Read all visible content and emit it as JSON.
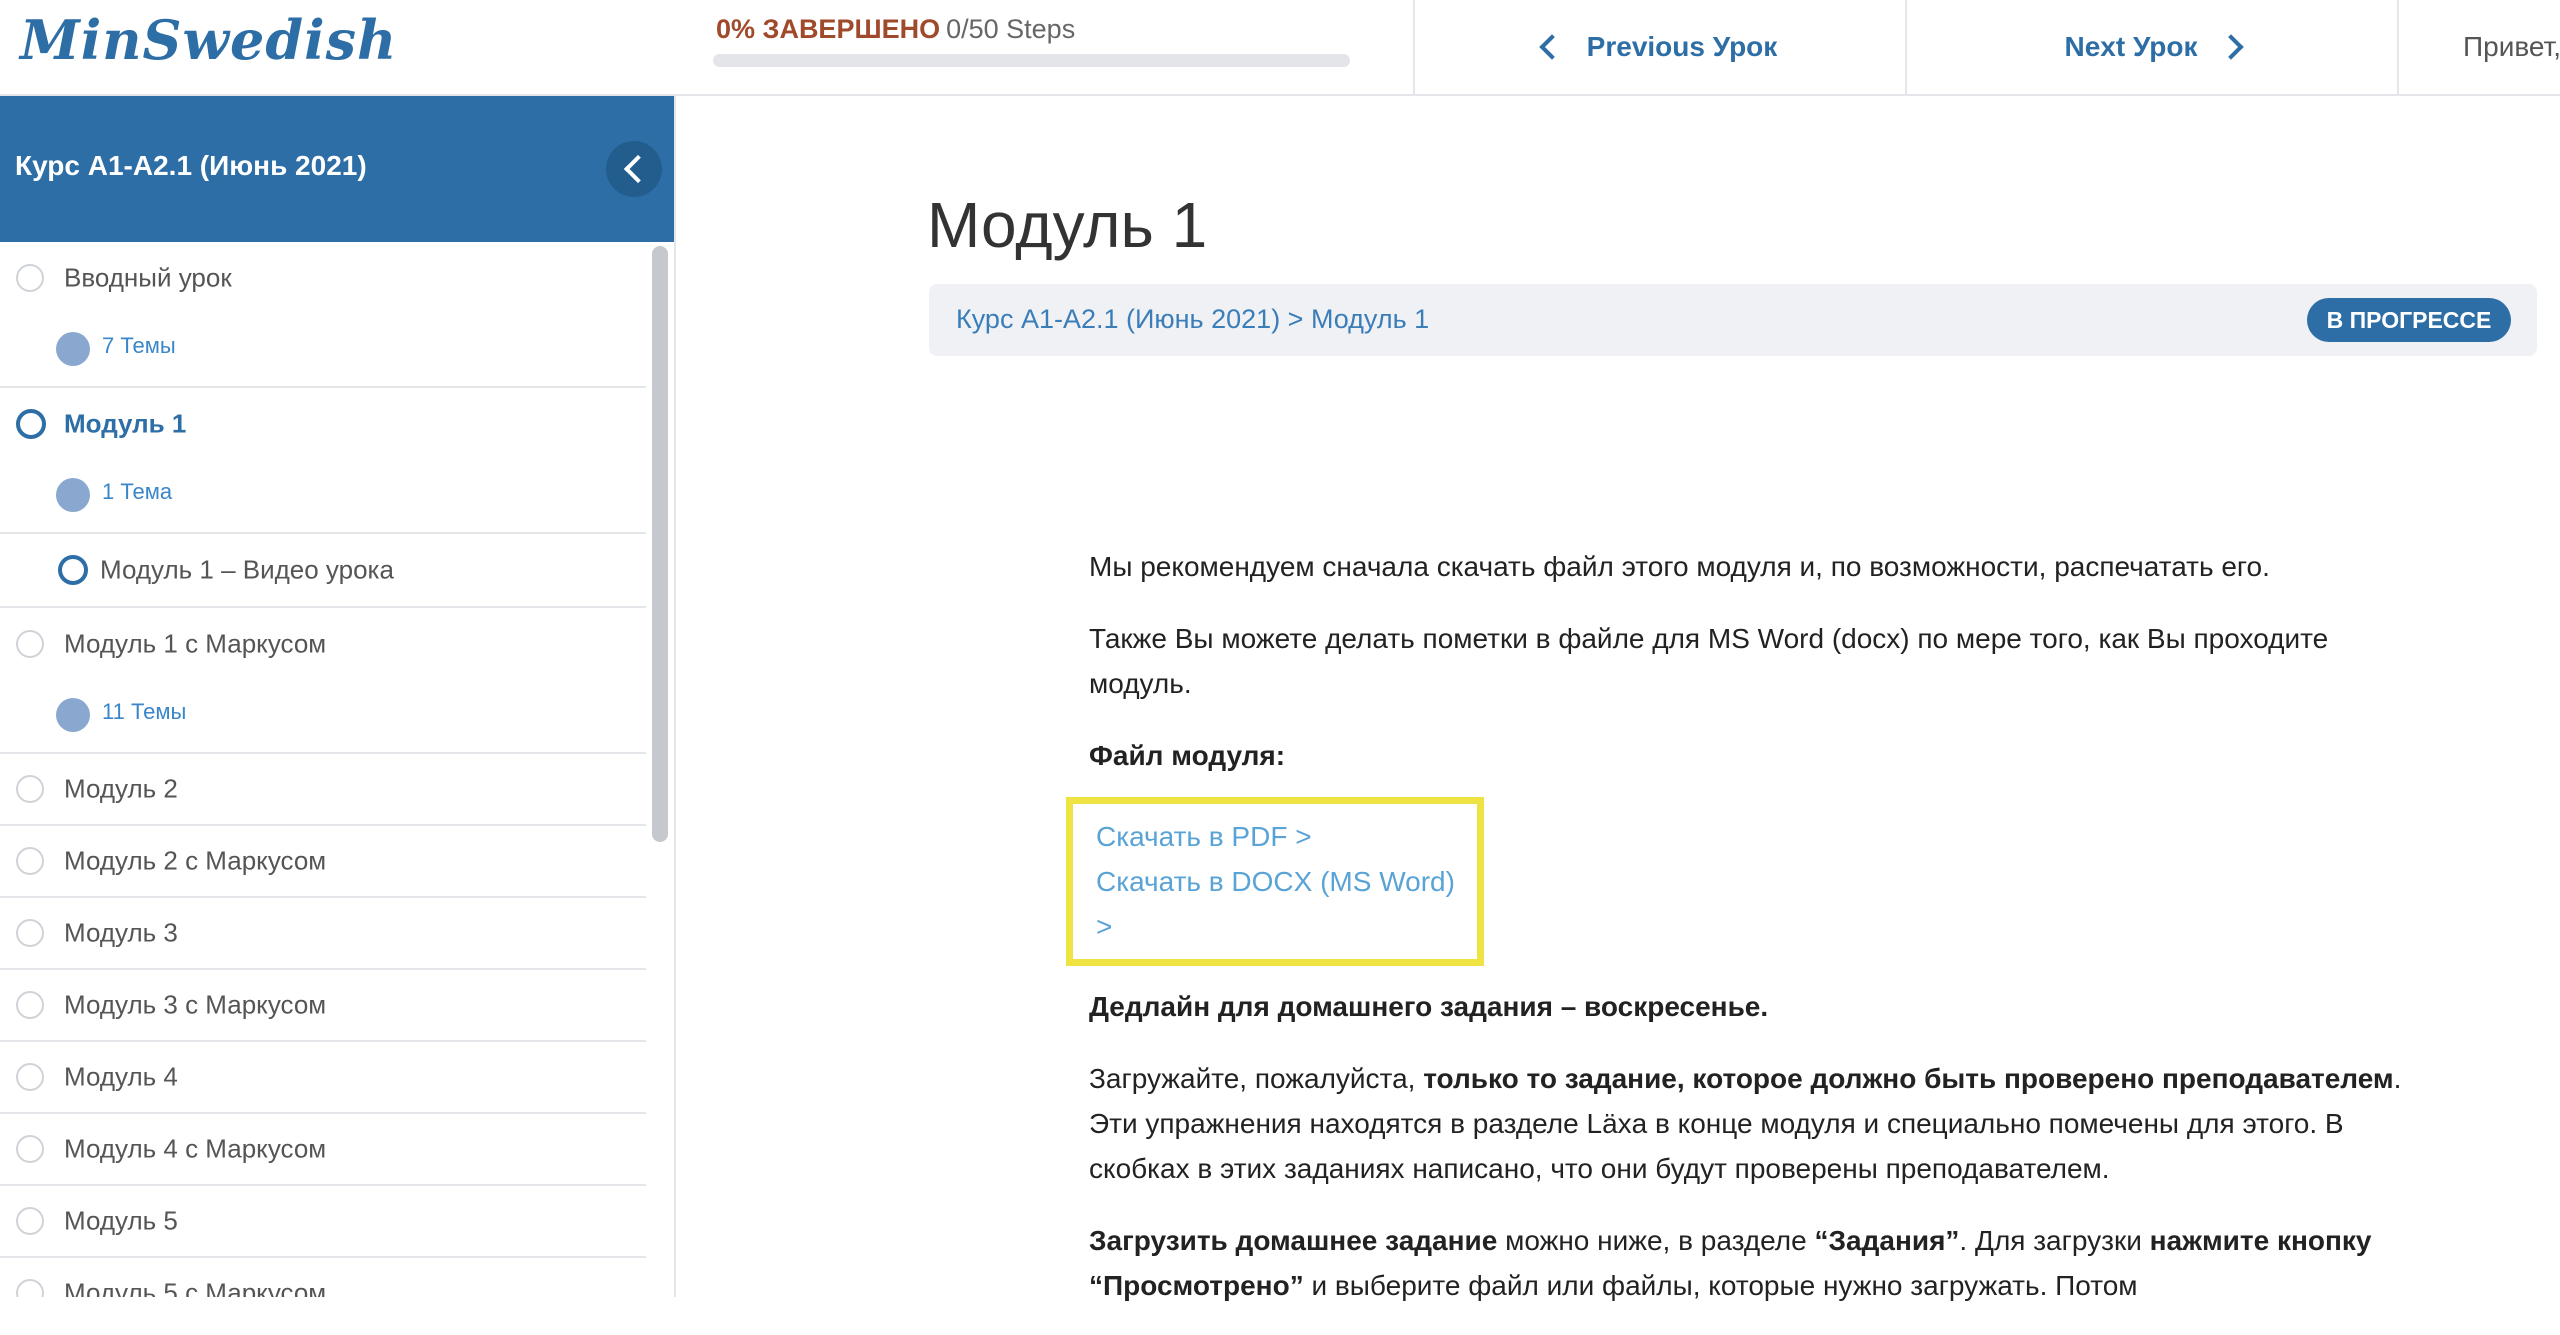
{
  "brand": {
    "logo": "MinSwedish"
  },
  "progress": {
    "percent_label": "0% ЗАВЕРШЕНО",
    "steps_label": "0/50 Steps",
    "fraction": 0.0
  },
  "nav": {
    "prev_label": "Previous Урок",
    "next_label": "Next Урок",
    "greeting": "Привет,"
  },
  "sidebar": {
    "course_title": "Курс A1-A2.1 (Июнь 2021)",
    "items": [
      {
        "label": "Вводный урок",
        "badge": "7 Темы"
      },
      {
        "label": "Модуль 1",
        "badge": "1 Тема",
        "sub": "Модуль 1 – Видео урока"
      },
      {
        "label": "Модуль 1 с Маркусом",
        "badge": "11 Темы"
      },
      {
        "label": "Модуль 2"
      },
      {
        "label": "Модуль 2 с Маркусом"
      },
      {
        "label": "Модуль 3"
      },
      {
        "label": "Модуль 3 с Маркусом"
      },
      {
        "label": "Модуль 4"
      },
      {
        "label": "Модуль 4 с Маркусом"
      },
      {
        "label": "Модуль 5"
      },
      {
        "label": "Модуль 5 с Маркусом"
      }
    ]
  },
  "main": {
    "title": "Модуль 1",
    "breadcrumb": "Курс A1-A2.1 (Июнь 2021) > Модуль 1",
    "status": "В ПРОГРЕССЕ",
    "p1": "Мы рекомендуем сначала скачать файл этого модуля и, по возможности, распечатать его.",
    "p2": "Также Вы можете делать пометки в файле для MS Word (docx) по мере того, как Вы проходите модуль.",
    "file_heading": "Файл модуля:",
    "pdf_link": "Скачать в PDF >",
    "docx_link": "Скачать в DOCX (MS Word) >",
    "deadline": "Дедлайн для домашнего задания – воскресенье.",
    "p3_a": "Загружайте, пожалуйста, ",
    "p3_b": "только то задание, которое должно быть проверено преподавателем",
    "p3_c": ". Эти упражнения находятся в разделе Läxa в конце модуля и специально помечены для этого. В скобках в этих заданиях написано, что они будут проверены преподавателем.",
    "p4_a": "Загрузить домашнее задание",
    "p4_b": " можно ниже, в разделе ",
    "p4_c": "“Задания”",
    "p4_d": ". Для загрузки ",
    "p4_e": "нажмите кнопку “Просмотрено”",
    "p4_f": " и выберите файл или файлы, которые нужно загружать. Потом"
  }
}
